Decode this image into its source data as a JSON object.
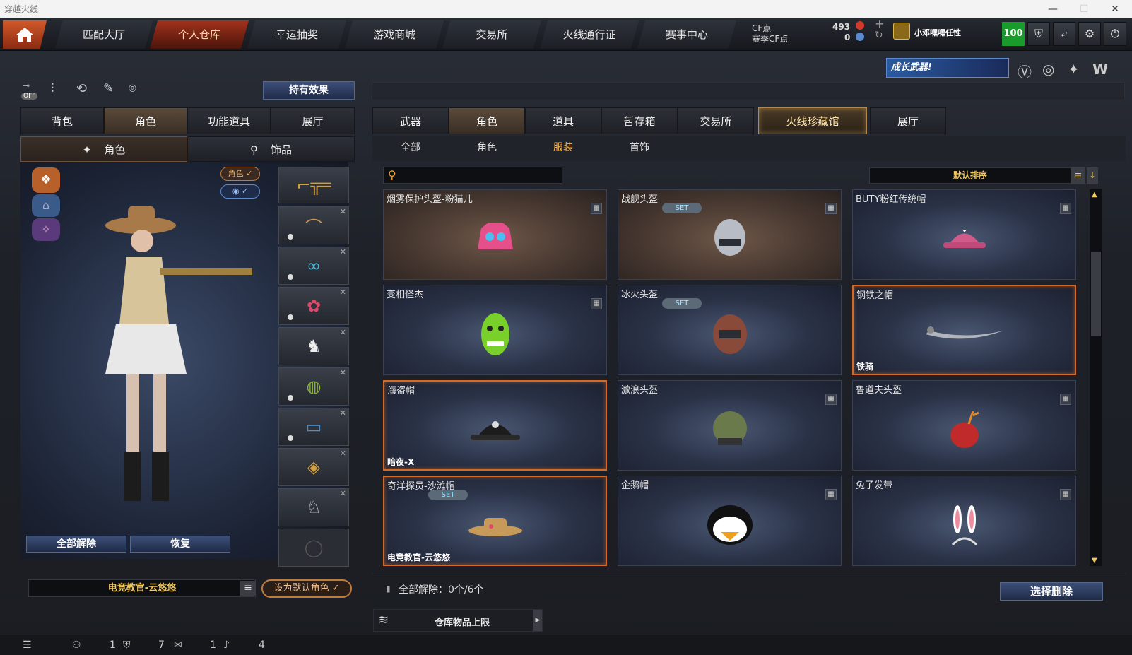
{
  "window": {
    "title": "穿越火线"
  },
  "nav": {
    "items": [
      "匹配大厅",
      "个人仓库",
      "幸运抽奖",
      "游戏商城",
      "交易所",
      "火线通行证",
      "赛事中心"
    ],
    "active_index": 1
  },
  "currency": {
    "cf_label": "CF点",
    "cf_value": "493",
    "season_label": "赛季CF点",
    "season_value": "0"
  },
  "user": {
    "name": "小邓嘿嘿任性",
    "level": "100"
  },
  "banner": {
    "text": "成长武器!"
  },
  "left": {
    "hold_effect_label": "持有效果",
    "off_label": "OFF",
    "tabs": [
      "背包",
      "角色",
      "功能道具",
      "展厅"
    ],
    "active_tab": 1,
    "subtabs": [
      "角色",
      "饰品"
    ],
    "role_badge": "角色 ✓",
    "remove_all_label": "全部解除",
    "restore_label": "恢复",
    "character_name": "电竞教官-云悠悠",
    "set_default_label": "设为默认角色 ✓"
  },
  "right": {
    "tabs": [
      "武器",
      "角色",
      "道具",
      "暂存箱",
      "交易所",
      "火线珍藏馆",
      "展厅"
    ],
    "active_tab": 1,
    "subtabs": [
      "全部",
      "角色",
      "服装",
      "首饰"
    ],
    "active_subtab": 2,
    "search": {
      "placeholder": ""
    },
    "sort_label": "默认排序",
    "items": [
      {
        "name": "烟雾保护头盔-粉猫儿",
        "set": false,
        "tag": "",
        "selected": false
      },
      {
        "name": "战舰头盔",
        "set": true,
        "tag": "",
        "selected": false
      },
      {
        "name": "BUTY粉红传统帽",
        "set": false,
        "tag": "",
        "selected": false
      },
      {
        "name": "变相怪杰",
        "set": false,
        "tag": "",
        "selected": false
      },
      {
        "name": "冰火头盔",
        "set": true,
        "tag": "",
        "selected": false
      },
      {
        "name": "钢铁之帽",
        "set": false,
        "tag": "铁骑",
        "selected": true
      },
      {
        "name": "海盗帽",
        "set": false,
        "tag": "暗夜-X",
        "selected": true
      },
      {
        "name": "激浪头盔",
        "set": false,
        "tag": "",
        "selected": false
      },
      {
        "name": "鲁道夫头盔",
        "set": false,
        "tag": "",
        "selected": false
      },
      {
        "name": "奇洋探员-沙滩帽",
        "set": true,
        "tag": "电竞教官-云悠悠",
        "selected": true
      },
      {
        "name": "企鹅帽",
        "set": false,
        "tag": "",
        "selected": false
      },
      {
        "name": "兔子发带",
        "set": false,
        "tag": "",
        "selected": false
      }
    ],
    "set_label": "SET",
    "remove_all_status": "全部解除：0个/6个",
    "select_delete_label": "选择删除",
    "storage_limit_label": "仓库物品上限"
  },
  "status": {
    "a": "1",
    "b": "7",
    "c": "1",
    "d": "4"
  }
}
